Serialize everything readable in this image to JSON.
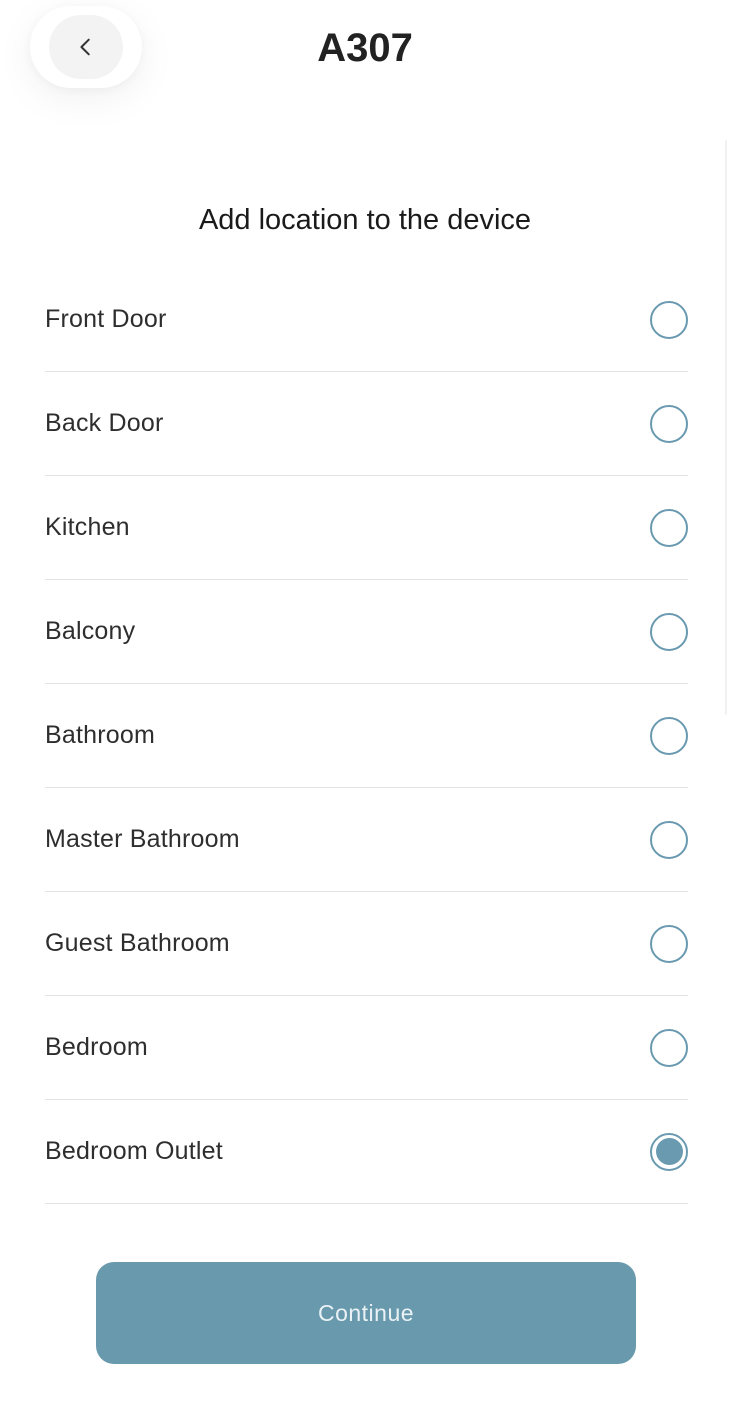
{
  "header": {
    "title": "A307",
    "back_icon": "chevron-left-icon"
  },
  "main": {
    "section_title": "Add location to the device",
    "locations": [
      {
        "label": "Front Door",
        "selected": false
      },
      {
        "label": "Back Door",
        "selected": false
      },
      {
        "label": "Kitchen",
        "selected": false
      },
      {
        "label": "Balcony",
        "selected": false
      },
      {
        "label": "Bathroom",
        "selected": false
      },
      {
        "label": "Master Bathroom",
        "selected": false
      },
      {
        "label": "Guest Bathroom",
        "selected": false
      },
      {
        "label": "Bedroom",
        "selected": false
      },
      {
        "label": "Bedroom Outlet",
        "selected": true
      }
    ]
  },
  "footer": {
    "continue_label": "Continue"
  },
  "colors": {
    "accent": "#6899ad",
    "radio": "#6a9ab0",
    "divider": "#e4e4e4"
  }
}
